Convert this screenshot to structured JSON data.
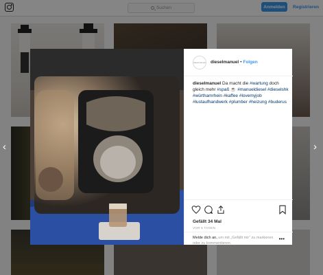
{
  "header": {
    "search_placeholder": "Suchen",
    "login_label": "Anmelden",
    "register_label": "Registrieren"
  },
  "post": {
    "username": "dieselmanuel",
    "separator": "•",
    "follow_label": "Folgen",
    "avatar_text": "dieselmanuel",
    "caption_user": "dieselmanuel",
    "caption_parts": [
      {
        "text": " Da macht die ",
        "tag": false
      },
      {
        "text": "#wartung",
        "tag": true
      },
      {
        "text": " doch gleich mehr ",
        "tag": false
      },
      {
        "text": "#spaß",
        "tag": true
      },
      {
        "text": " ☕ ",
        "tag": false
      },
      {
        "text": "#manueldiesel",
        "tag": true
      },
      {
        "text": " ",
        "tag": false
      },
      {
        "text": "#dieselshk",
        "tag": true
      },
      {
        "text": " ",
        "tag": false
      },
      {
        "text": "#würthamrhein",
        "tag": true
      },
      {
        "text": " ",
        "tag": false
      },
      {
        "text": "#kaffee",
        "tag": true
      },
      {
        "text": " ",
        "tag": false
      },
      {
        "text": "#lovemyjob",
        "tag": true
      },
      {
        "text": " ",
        "tag": false
      },
      {
        "text": "#lustaufhandwerk",
        "tag": true
      },
      {
        "text": " ",
        "tag": false
      },
      {
        "text": "#plumber",
        "tag": true
      },
      {
        "text": " ",
        "tag": false
      },
      {
        "text": "#heizung",
        "tag": true
      },
      {
        "text": " ",
        "tag": false
      },
      {
        "text": "#buderus",
        "tag": true
      }
    ],
    "likes": "Gefällt 34 Mal",
    "time": "VOR 5 TAGEN",
    "login_prompt_link": "Melde dich an,",
    "login_prompt_rest": " um mit „Gefällt mir“ zu markieren oder zu kommentieren.",
    "more_glyph": "•••"
  },
  "icons": {
    "instagram": "instagram-icon",
    "search": "search-icon",
    "heart": "heart-icon",
    "comment": "comment-icon",
    "share": "share-icon",
    "bookmark": "bookmark-icon",
    "prev": "chevron-left-icon",
    "next": "chevron-right-icon"
  },
  "nav": {
    "prev_glyph": "‹",
    "next_glyph": "›"
  },
  "colors": {
    "accent": "#3897f0",
    "hashtag": "#003569",
    "text": "#262626",
    "muted": "#999999"
  }
}
